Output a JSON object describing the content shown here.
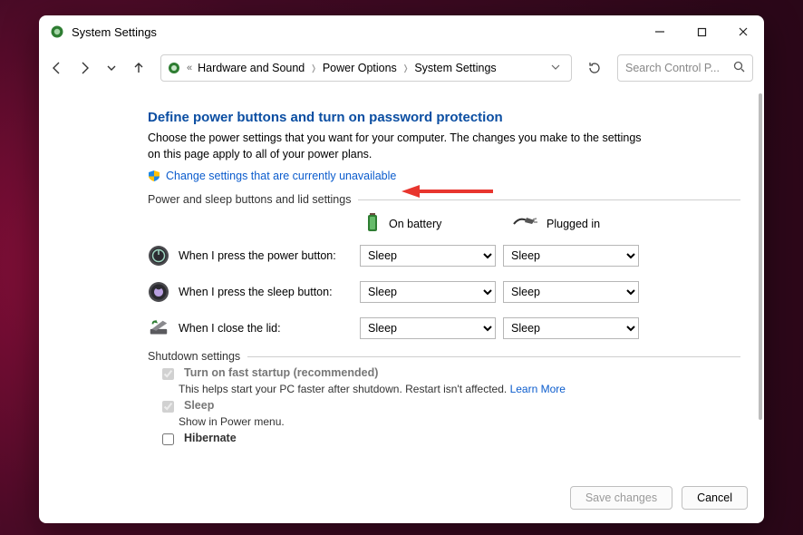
{
  "window": {
    "title": "System Settings"
  },
  "breadcrumb": {
    "items": [
      "Hardware and Sound",
      "Power Options",
      "System Settings"
    ]
  },
  "search": {
    "placeholder": "Search Control P..."
  },
  "page": {
    "heading": "Define power buttons and turn on password protection",
    "description": "Choose the power settings that you want for your computer. The changes you make to the settings on this page apply to all of your power plans.",
    "change_link": "Change settings that are currently unavailable"
  },
  "columns": {
    "battery": "On battery",
    "plugged": "Plugged in"
  },
  "sections": {
    "buttons_title": "Power and sleep buttons and lid settings",
    "shutdown_title": "Shutdown settings"
  },
  "rows": [
    {
      "label": "When I press the power button:",
      "battery": "Sleep",
      "plugged": "Sleep"
    },
    {
      "label": "When I press the sleep button:",
      "battery": "Sleep",
      "plugged": "Sleep"
    },
    {
      "label": "When I close the lid:",
      "battery": "Sleep",
      "plugged": "Sleep"
    }
  ],
  "shutdown": {
    "fast_startup": {
      "label": "Turn on fast startup (recommended)",
      "sub_pre": "This helps start your PC faster after shutdown. Restart isn't affected. ",
      "learn_more": "Learn More"
    },
    "sleep": {
      "label": "Sleep",
      "sub": "Show in Power menu."
    },
    "hibernate": {
      "label": "Hibernate"
    }
  },
  "footer": {
    "save": "Save changes",
    "cancel": "Cancel"
  }
}
